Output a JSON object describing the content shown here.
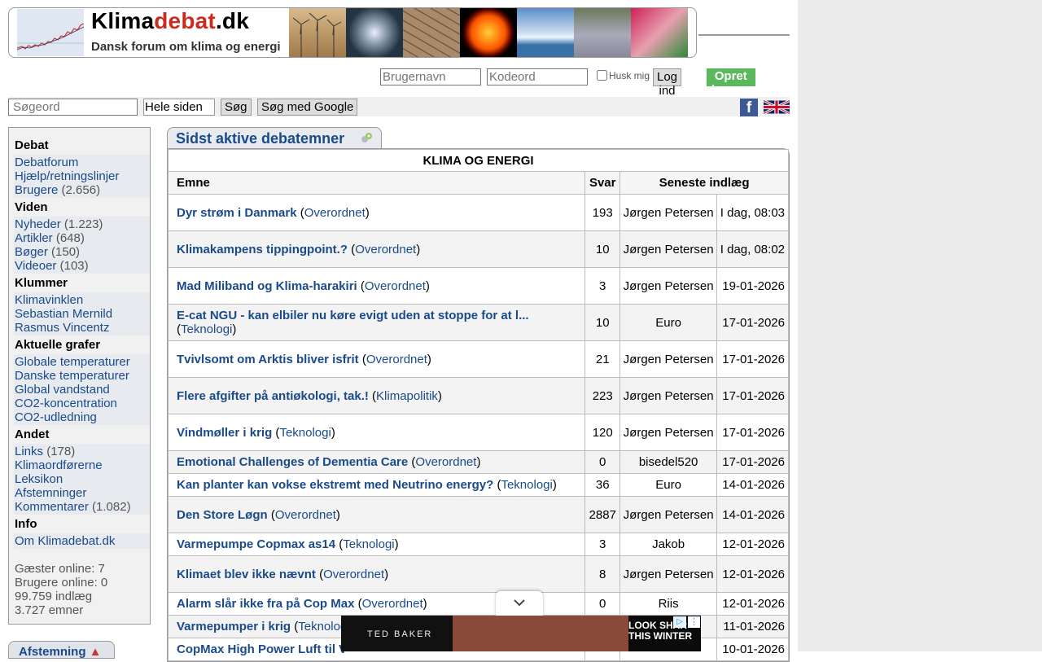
{
  "site": {
    "title_part1": "Klima",
    "title_part2": "debat",
    "title_part3": ".dk",
    "subtitle": "Dansk forum om klima og energi"
  },
  "login": {
    "username_placeholder": "Brugernavn",
    "password_placeholder": "Kodeord",
    "remember_label": "Husk mig",
    "login_label": "Log ind",
    "create_label": "Opret bruger"
  },
  "search": {
    "placeholder": "Søgeord",
    "scope": "Hele siden",
    "search_label": "Søg",
    "google_label": "Søg med Google"
  },
  "sidebar": {
    "debat_heading": "Debat",
    "debat_items": [
      {
        "label": "Debatforum",
        "count": ""
      },
      {
        "label": "Hjælp/retningslinjer",
        "count": ""
      },
      {
        "label": "Brugere",
        "count": "(2.656)"
      }
    ],
    "viden_heading": "Viden",
    "viden_items": [
      {
        "label": "Nyheder",
        "count": "(1.223)"
      },
      {
        "label": "Artikler",
        "count": "(648)"
      },
      {
        "label": "Bøger",
        "count": "(150)"
      },
      {
        "label": "Videoer",
        "count": "(103)"
      }
    ],
    "klummer_heading": "Klummer",
    "klummer_items": [
      {
        "label": "Klimavinklen"
      },
      {
        "label": "Sebastian Mernild"
      },
      {
        "label": "Rasmus Vincentz"
      }
    ],
    "grafer_heading": "Aktuelle grafer",
    "grafer_items": [
      {
        "label": "Globale temperaturer"
      },
      {
        "label": "Danske temperaturer"
      },
      {
        "label": "Global vandstand"
      },
      {
        "label": "CO2-koncentration"
      },
      {
        "label": "CO2-udledning"
      }
    ],
    "andet_heading": "Andet",
    "andet_items": [
      {
        "label": "Links",
        "count": "(178)"
      },
      {
        "label": "Klimaordførerne",
        "count": ""
      },
      {
        "label": "Leksikon",
        "count": ""
      },
      {
        "label": "Afstemninger",
        "count": ""
      },
      {
        "label": "Kommentarer",
        "count": "(1.082)"
      }
    ],
    "info_heading": "Info",
    "info_items": [
      {
        "label": "Om Klimadebat.dk"
      }
    ],
    "stats": [
      "Gæster online: 7",
      "Brugere online: 0",
      "99.759 indlæg",
      "3.727 emner"
    ],
    "poll_tab": "Afstemning"
  },
  "main": {
    "tab_title": "Sidst aktive debatemner",
    "category": "KLIMA OG ENERGI",
    "headers": {
      "topic": "Emne",
      "replies": "Svar",
      "latest": "Seneste indlæg"
    },
    "rows": [
      {
        "title": "Dyr strøm i Danmark",
        "cat": "Overordnet",
        "replies": "193",
        "author": "Jørgen Petersen",
        "date": "I dag, 08:03"
      },
      {
        "title": "Klimakampens tippingpoint.?",
        "cat": "Overordnet",
        "replies": "10",
        "author": "Jørgen Petersen",
        "date": "I dag, 08:02"
      },
      {
        "title": "Mad Miliband og Klima-harakiri",
        "cat": "Overordnet",
        "replies": "3",
        "author": "Jørgen Petersen",
        "date": "19-01-2026"
      },
      {
        "title": "E-cat NGU - kan elbiler nu køre evigt uden at stoppe for at l...",
        "cat": "Teknologi",
        "replies": "10",
        "author": "Euro",
        "date": "17-01-2026"
      },
      {
        "title": "Tvivlsomt om Arktis bliver isfrit",
        "cat": "Overordnet",
        "replies": "21",
        "author": "Jørgen Petersen",
        "date": "17-01-2026"
      },
      {
        "title": "Flere afgifter på antiøkologi, tak.!",
        "cat": "Klimapolitik",
        "replies": "223",
        "author": "Jørgen Petersen",
        "date": "17-01-2026"
      },
      {
        "title": "Vindmøller i krig",
        "cat": "Teknologi",
        "replies": "120",
        "author": "Jørgen Petersen",
        "date": "17-01-2026"
      },
      {
        "title": "Emotional Challenges of Dementia Care",
        "cat": "Overordnet",
        "replies": "0",
        "author": "bisedel520",
        "date": "17-01-2026"
      },
      {
        "title": "Kan planter kan vokse ekstremt med Neutrino energy?",
        "cat": "Teknologi",
        "replies": "36",
        "author": "Euro",
        "date": "14-01-2026"
      },
      {
        "title": "Den Store Løgn",
        "cat": "Overordnet",
        "replies": "2887",
        "author": "Jørgen Petersen",
        "date": "14-01-2026"
      },
      {
        "title": "Varmepumpe Copmax as14",
        "cat": "Teknologi",
        "replies": "3",
        "author": "Jakob",
        "date": "12-01-2026"
      },
      {
        "title": "Klimaet blev ikke nævnt",
        "cat": "Overordnet",
        "replies": "8",
        "author": "Jørgen Petersen",
        "date": "12-01-2026"
      },
      {
        "title": "Alarm slår ikke fra på Cop Max",
        "cat": "Overordnet",
        "replies": "0",
        "author": "Riis",
        "date": "12-01-2026"
      },
      {
        "title": "Varmepumper i krig",
        "cat": "Teknologi",
        "replies": "",
        "author": "",
        "date": "11-01-2026"
      },
      {
        "title": "CopMax High Power Luft til V",
        "cat": "",
        "replies": "",
        "author": "",
        "date": "10-01-2026"
      }
    ]
  },
  "ad": {
    "brand": "TED BAKER",
    "text_line1": "LOOK SHAR",
    "text_line2": "THIS WINTER"
  }
}
